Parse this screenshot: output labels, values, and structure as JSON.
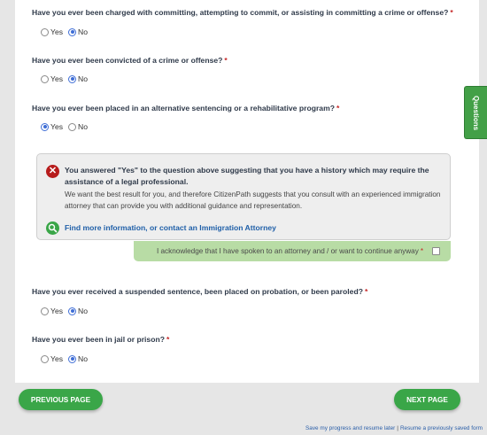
{
  "side_tab": {
    "label": "Questions"
  },
  "questions": [
    {
      "text": "Have you ever been charged with committing, attempting to commit, or assisting in committing a crime or offense?",
      "required": "*",
      "options": [
        "Yes",
        "No"
      ],
      "selected": "No"
    },
    {
      "text": "Have you ever been convicted of a crime or offense?",
      "required": "*",
      "options": [
        "Yes",
        "No"
      ],
      "selected": "No"
    },
    {
      "text": "Have you ever been placed in an alternative sentencing or a rehabilitative program?",
      "required": "*",
      "options": [
        "Yes",
        "No"
      ],
      "selected": "Yes"
    },
    {
      "text": "Have you ever received a suspended sentence, been placed on probation, or been paroled?",
      "required": "*",
      "options": [
        "Yes",
        "No"
      ],
      "selected": "No"
    },
    {
      "text": "Have you ever been in jail or prison?",
      "required": "*",
      "options": [
        "Yes",
        "No"
      ],
      "selected": "No"
    }
  ],
  "alert": {
    "title": "You answered \"Yes\" to the question above suggesting that you have a history which may require the assistance of a legal professional.",
    "body": "We want the best result for you, and therefore CitizenPath suggests that you consult with an experienced immigration attorney that can provide you with additional guidance and representation.",
    "link": "Find more information, or contact an Immigration Attorney",
    "acknowledge": "I acknowledge that I have spoken to an attorney and / or want to continue anyway",
    "acknowledge_required": "*"
  },
  "buttons": {
    "previous": "PREVIOUS PAGE",
    "next": "NEXT PAGE"
  },
  "footer": {
    "save": "Save my progress and resume later",
    "separator": "|",
    "resume": "Resume a previously saved form"
  },
  "colors": {
    "accent_green": "#3aa648",
    "error_red": "#b71c1c",
    "link_blue": "#1f5fa8",
    "ack_green": "#b8dca5"
  }
}
